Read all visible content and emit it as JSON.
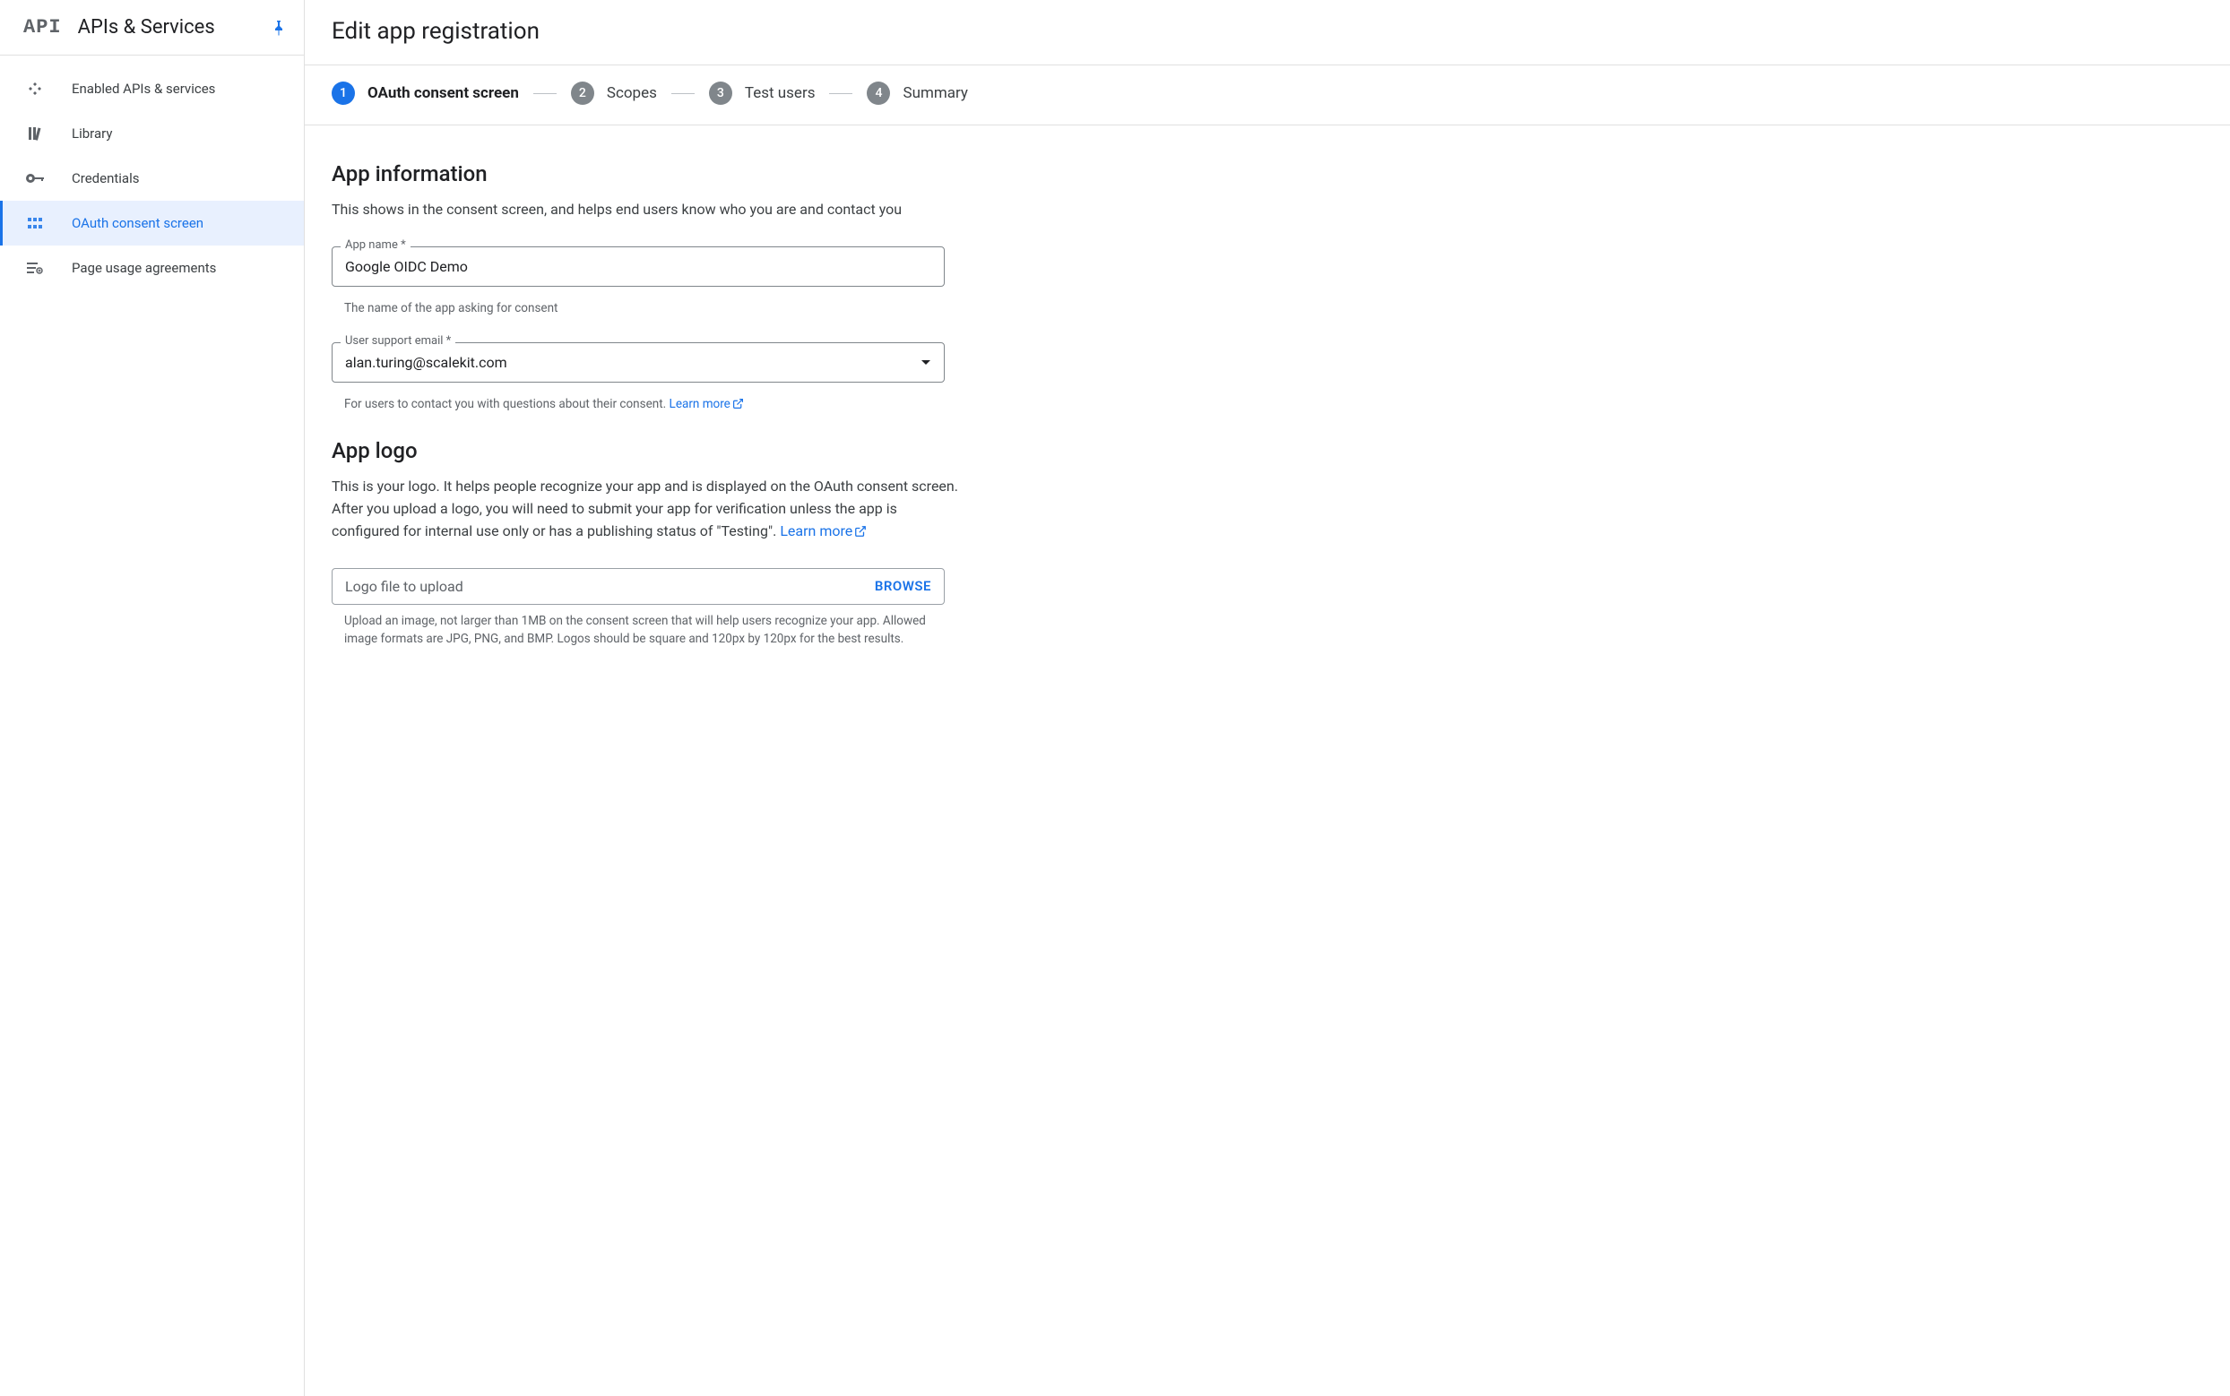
{
  "sidebar": {
    "logo_text": "API",
    "title": "APIs & Services",
    "items": [
      {
        "label": "Enabled APIs & services"
      },
      {
        "label": "Library"
      },
      {
        "label": "Credentials"
      },
      {
        "label": "OAuth consent screen"
      },
      {
        "label": "Page usage agreements"
      }
    ]
  },
  "page": {
    "title": "Edit app registration"
  },
  "stepper": {
    "steps": [
      {
        "num": "1",
        "label": "OAuth consent screen"
      },
      {
        "num": "2",
        "label": "Scopes"
      },
      {
        "num": "3",
        "label": "Test users"
      },
      {
        "num": "4",
        "label": "Summary"
      }
    ]
  },
  "app_info": {
    "heading": "App information",
    "description": "This shows in the consent screen, and helps end users know who you are and contact you",
    "app_name_label": "App name *",
    "app_name_value": "Google OIDC Demo",
    "app_name_helper": "The name of the app asking for consent",
    "support_email_label": "User support email *",
    "support_email_value": "alan.turing@scalekit.com",
    "support_email_helper": "For users to contact you with questions about their consent. ",
    "learn_more": "Learn more"
  },
  "app_logo": {
    "heading": "App logo",
    "desc_line1": "This is your logo. It helps people recognize your app and is displayed on the OAuth consent screen.",
    "desc_line2a": "After you upload a logo, you will need to submit your app for verification unless the app is configured for internal use only or has a publishing status of \"Testing\". ",
    "learn_more": "Learn more",
    "upload_placeholder": "Logo file to upload",
    "browse_label": "BROWSE",
    "upload_helper": "Upload an image, not larger than 1MB on the consent screen that will help users recognize your app. Allowed image formats are JPG, PNG, and BMP. Logos should be square and 120px by 120px for the best results."
  }
}
